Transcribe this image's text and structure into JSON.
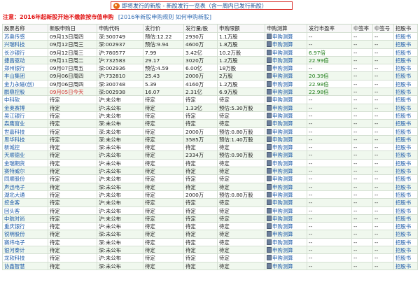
{
  "title": "即将发行的新股 - 新股发行一览表（含一周内已发行新股）",
  "notice": {
    "text": "注意：2016年起新股开始不缴款按市值申购",
    "links": "[2016年新股申购规则 如何申购新股]"
  },
  "table": {
    "headers": [
      "股票名称",
      "新股申购日",
      "申购代码",
      "发行价",
      "发行量/股",
      "申购限额",
      "申购测算",
      "发行市盈率",
      "中签率",
      "中签号",
      "招股书"
    ],
    "rows": [
      {
        "name": "苏奥传感",
        "date": "09月13日周四",
        "code": "深:300749",
        "price": "预估:12.22",
        "vol": "2930万",
        "limit": "1.1万股",
        "calc": "申购测算",
        "pe": "--",
        "rate": "--",
        "num": "--",
        "prospectus": "招股书"
      },
      {
        "name": "兴瑞科技",
        "date": "09月12日周三",
        "code": "深:002937",
        "price": "预估:9.94",
        "vol": "4600万",
        "limit": "1.8万股",
        "calc": "申购测算",
        "pe": "--",
        "rate": "--",
        "num": "--",
        "prospectus": "招股书"
      },
      {
        "name": "长沙银行",
        "date": "09月12日周三",
        "code": "沪:780577",
        "price": "7.99",
        "vol": "3.42亿",
        "limit": "10.2万股",
        "calc": "申购测算",
        "pe": "6.97倍",
        "rate": "--",
        "num": "--",
        "prospectus": "招股书"
      },
      {
        "name": "捷昌驱动",
        "date": "09月11日周二",
        "code": "沪:732583",
        "price": "29.17",
        "vol": "3020万",
        "limit": "1.2万股",
        "calc": "申购测算",
        "pe": "22.99倍",
        "rate": "--",
        "num": "--",
        "prospectus": "招股书"
      },
      {
        "name": "郑州银行",
        "date": "09月07日周五",
        "code": "深:002936",
        "price": "预估:4.59",
        "vol": "6.00亿",
        "limit": "18万股",
        "calc": "申购测算",
        "pe": "--",
        "rate": "--",
        "num": "--",
        "prospectus": "招股书"
      },
      {
        "name": "丰山集团",
        "date": "09月06日周四",
        "code": "沪:732810",
        "price": "25.43",
        "vol": "2000万",
        "limit": "2万股",
        "calc": "申购测算",
        "pe": "20.39倍",
        "rate": "--",
        "num": "--",
        "prospectus": "招股书"
      },
      {
        "name": "金力永磁(创)",
        "date": "09月06日周四",
        "code": "深:300748",
        "price": "5.39",
        "vol": "4160万",
        "limit": "1.2万股",
        "calc": "申购测算",
        "pe": "22.98倍",
        "rate": "--",
        "num": "--",
        "prospectus": "招股书"
      },
      {
        "name": "鹏鼎控股",
        "date": "09月05日今天",
        "code": "深:002938",
        "price": "16.07",
        "vol": "2.31亿",
        "limit": "6.9万股",
        "calc": "申购测算",
        "pe": "22.98倍",
        "rate": "--",
        "num": "--",
        "prospectus": "招股书"
      },
      {
        "name": "中科软",
        "date": "待定",
        "code": "沪:未公布",
        "price": "待定",
        "vol": "待定",
        "limit": "待定",
        "calc": "申购测算",
        "pe": "--",
        "rate": "--",
        "num": "--",
        "prospectus": "招股书"
      },
      {
        "name": "金奥赛博",
        "date": "待定",
        "code": "沪:未公布",
        "price": "待定",
        "vol": "1.33亿",
        "limit": "预估:5.30万股",
        "calc": "申购测算",
        "pe": "--",
        "rate": "--",
        "num": "--",
        "prospectus": "招股书"
      },
      {
        "name": "吴江银行",
        "date": "待定",
        "code": "沪:未公布",
        "price": "待定",
        "vol": "待定",
        "limit": "待定",
        "calc": "申购测算",
        "pe": "--",
        "rate": "--",
        "num": "--",
        "prospectus": "招股书"
      },
      {
        "name": "森鹰窗业",
        "date": "待定",
        "code": "深:未公布",
        "price": "待定",
        "vol": "待定",
        "limit": "待定",
        "calc": "申购测算",
        "pe": "--",
        "rate": "--",
        "num": "--",
        "prospectus": "招股书"
      },
      {
        "name": "世嘉科技",
        "date": "待定",
        "code": "深:未公布",
        "price": "待定",
        "vol": "2000万",
        "limit": "预估:0.80万股",
        "calc": "申购测算",
        "pe": "--",
        "rate": "--",
        "num": "--",
        "prospectus": "招股书"
      },
      {
        "name": "思华科技",
        "date": "待定",
        "code": "深:未公布",
        "price": "待定",
        "vol": "3585万",
        "limit": "预估:1.40万股",
        "calc": "申购测算",
        "pe": "--",
        "rate": "--",
        "num": "--",
        "prospectus": "招股书"
      },
      {
        "name": "新城控",
        "date": "待定",
        "code": "深:未公布",
        "price": "待定",
        "vol": "待定",
        "limit": "待定",
        "calc": "申购测算",
        "pe": "--",
        "rate": "--",
        "num": "--",
        "prospectus": "招股书"
      },
      {
        "name": "天顺德业",
        "date": "待定",
        "code": "沪:未公布",
        "price": "待定",
        "vol": "2334万",
        "limit": "预估:0.90万股",
        "calc": "申购测算",
        "pe": "--",
        "rate": "--",
        "num": "--",
        "prospectus": "招股书"
      },
      {
        "name": "金瑞期货",
        "date": "待定",
        "code": "沪:未公布",
        "price": "待定",
        "vol": "待定",
        "limit": "待定",
        "calc": "申购测算",
        "pe": "--",
        "rate": "--",
        "num": "--",
        "prospectus": "招股书"
      },
      {
        "name": "赛特威尔",
        "date": "待定",
        "code": "沪:未公布",
        "price": "待定",
        "vol": "待定",
        "limit": "待定",
        "calc": "申购测算",
        "pe": "--",
        "rate": "--",
        "num": "--",
        "prospectus": "招股书"
      },
      {
        "name": "同顺股份",
        "date": "待定",
        "code": "沪:未公布",
        "price": "待定",
        "vol": "待定",
        "limit": "待定",
        "calc": "申购测算",
        "pe": "--",
        "rate": "--",
        "num": "--",
        "prospectus": "招股书"
      },
      {
        "name": "声迅电子",
        "date": "待定",
        "code": "深:未公布",
        "price": "待定",
        "vol": "待定",
        "limit": "待定",
        "calc": "申购测算",
        "pe": "--",
        "rate": "--",
        "num": "--",
        "prospectus": "招股书"
      },
      {
        "name": "湖北大通",
        "date": "待定",
        "code": "沪:未公布",
        "price": "待定",
        "vol": "2000万",
        "limit": "预估:0.80万股",
        "calc": "申购测算",
        "pe": "--",
        "rate": "--",
        "num": "--",
        "prospectus": "招股书"
      },
      {
        "name": "挖金客",
        "date": "待定",
        "code": "沪:未公布",
        "price": "待定",
        "vol": "待定",
        "limit": "待定",
        "calc": "申购测算",
        "pe": "--",
        "rate": "--",
        "num": "--",
        "prospectus": "招股书"
      },
      {
        "name": "回头客",
        "date": "待定",
        "code": "沪:未公布",
        "price": "待定",
        "vol": "待定",
        "limit": "待定",
        "calc": "申购测算",
        "pe": "--",
        "rate": "--",
        "num": "--",
        "prospectus": "招股书"
      },
      {
        "name": "中航时尚",
        "date": "待定",
        "code": "沪:未公布",
        "price": "待定",
        "vol": "待定",
        "limit": "待定",
        "calc": "申购测算",
        "pe": "--",
        "rate": "--",
        "num": "--",
        "prospectus": "招股书"
      },
      {
        "name": "重庆银行",
        "date": "待定",
        "code": "沪:未公布",
        "price": "待定",
        "vol": "待定",
        "limit": "待定",
        "calc": "申购测算",
        "pe": "--",
        "rate": "--",
        "num": "--",
        "prospectus": "招股书"
      },
      {
        "name": "锐明股份",
        "date": "待定",
        "code": "深:未公布",
        "price": "待定",
        "vol": "待定",
        "limit": "待定",
        "calc": "申购测算",
        "pe": "--",
        "rate": "--",
        "num": "--",
        "prospectus": "招股书"
      },
      {
        "name": "赛纬电子",
        "date": "待定",
        "code": "深:未公布",
        "price": "待定",
        "vol": "待定",
        "limit": "待定",
        "calc": "申购测算",
        "pe": "--",
        "rate": "--",
        "num": "--",
        "prospectus": "招股书"
      },
      {
        "name": "银河泰计",
        "date": "待定",
        "code": "深:未公布",
        "price": "待定",
        "vol": "待定",
        "limit": "待定",
        "calc": "申购测算",
        "pe": "--",
        "rate": "--",
        "num": "--",
        "prospectus": "招股书"
      },
      {
        "name": "龙软科技",
        "date": "待定",
        "code": "沪:未公布",
        "price": "待定",
        "vol": "待定",
        "limit": "待定",
        "calc": "申购测算",
        "pe": "--",
        "rate": "--",
        "num": "--",
        "prospectus": "招股书"
      },
      {
        "name": "协鑫智慧",
        "date": "待定",
        "code": "深:未公布",
        "price": "待定",
        "vol": "待定",
        "limit": "待定",
        "calc": "申购测算",
        "pe": "--",
        "rate": "--",
        "num": "--",
        "prospectus": "招股书"
      }
    ]
  }
}
